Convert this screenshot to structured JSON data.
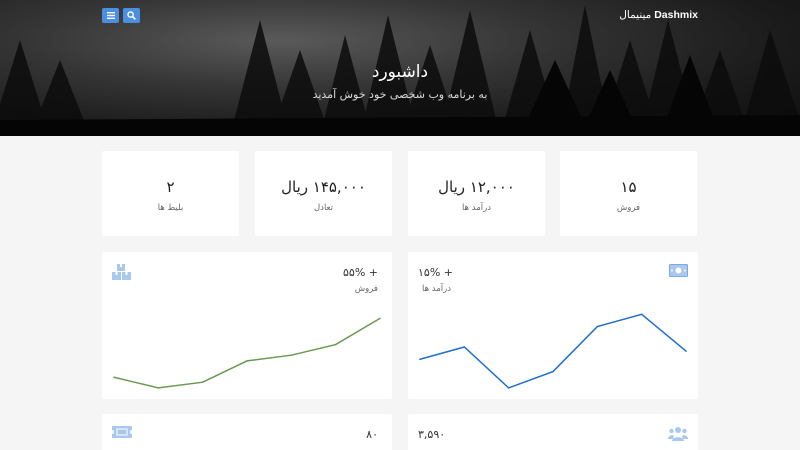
{
  "header": {
    "brand_bold": "Dashmix",
    "brand_light": "مینیمال",
    "title": "داشبورد",
    "subtitle": "به برنامه وب شخصی خود خوش آمدید"
  },
  "toolbar": {
    "menu_icon": "menu-icon",
    "search_icon": "search-icon"
  },
  "stats": [
    {
      "value": "۱۵",
      "label": "فروش"
    },
    {
      "value": "۱۲,۰۰۰ ریال",
      "label": "درآمد ها"
    },
    {
      "value": "۱۴۵,۰۰۰ ریال",
      "label": "تعادل"
    },
    {
      "value": "۲",
      "label": "بلیط ها"
    }
  ],
  "charts": {
    "income": {
      "percent": "+ ۱۵%",
      "label": "درآمد ها",
      "icon": "money-bill-icon",
      "color": "#1f6fcf"
    },
    "sales": {
      "percent": "+ ۵۵%",
      "label": "فروش",
      "icon": "boxes-icon",
      "color": "#6a9a50"
    }
  },
  "chart_data": [
    {
      "type": "line",
      "series": [
        {
          "values": [
            4,
            5.5,
            0.5,
            2.5,
            8,
            9.5,
            5
          ]
        }
      ],
      "ylim": [
        0,
        11
      ]
    },
    {
      "type": "line",
      "series": [
        {
          "values": [
            1.8,
            0.5,
            1.2,
            3.8,
            4.5,
            5.8,
            9
          ]
        }
      ],
      "ylim": [
        0,
        11
      ]
    }
  ],
  "bottom": {
    "users": {
      "value": "۳,۵۹۰",
      "icon": "users-icon"
    },
    "tickets": {
      "value": "۸۰",
      "icon": "ticket-icon"
    }
  }
}
